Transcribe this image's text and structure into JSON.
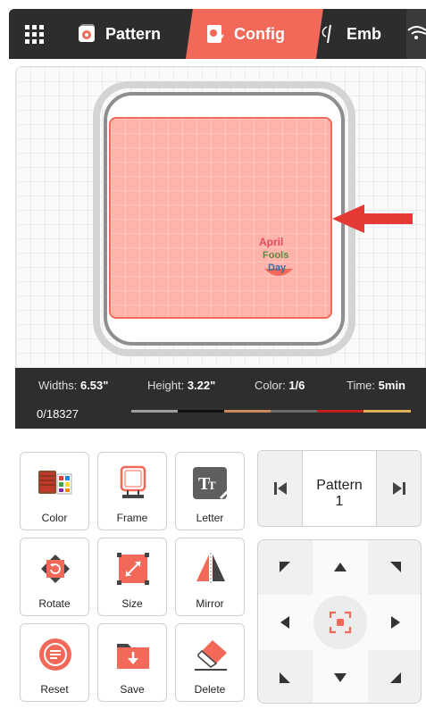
{
  "tabs": {
    "pattern_label": "Pattern",
    "config_label": "Config",
    "emb_label": "Emb"
  },
  "accent_color": "#f2695a",
  "info": {
    "widths_label": "Widths:",
    "widths_value": "6.53\"",
    "height_label": "Height:",
    "height_value": "3.22\"",
    "color_label": "Color:",
    "color_value": "1/6",
    "time_label": "Time:",
    "time_value": "5min",
    "stitch_progress": "0/18327",
    "thread_colors": [
      "#9e9e9e",
      "#111111",
      "#c9895a",
      "#6b6b6b",
      "#c02020",
      "#e0b15a"
    ]
  },
  "tools": {
    "color": "Color",
    "frame": "Frame",
    "letter": "Letter",
    "rotate": "Rotate",
    "size": "Size",
    "mirror": "Mirror",
    "reset": "Reset",
    "save": "Save",
    "delete": "Delete"
  },
  "pattern_nav": {
    "label_line1": "Pattern",
    "label_line2": "1"
  },
  "logo": {
    "line1": "April",
    "line2": "Fools",
    "line3": "Day"
  }
}
